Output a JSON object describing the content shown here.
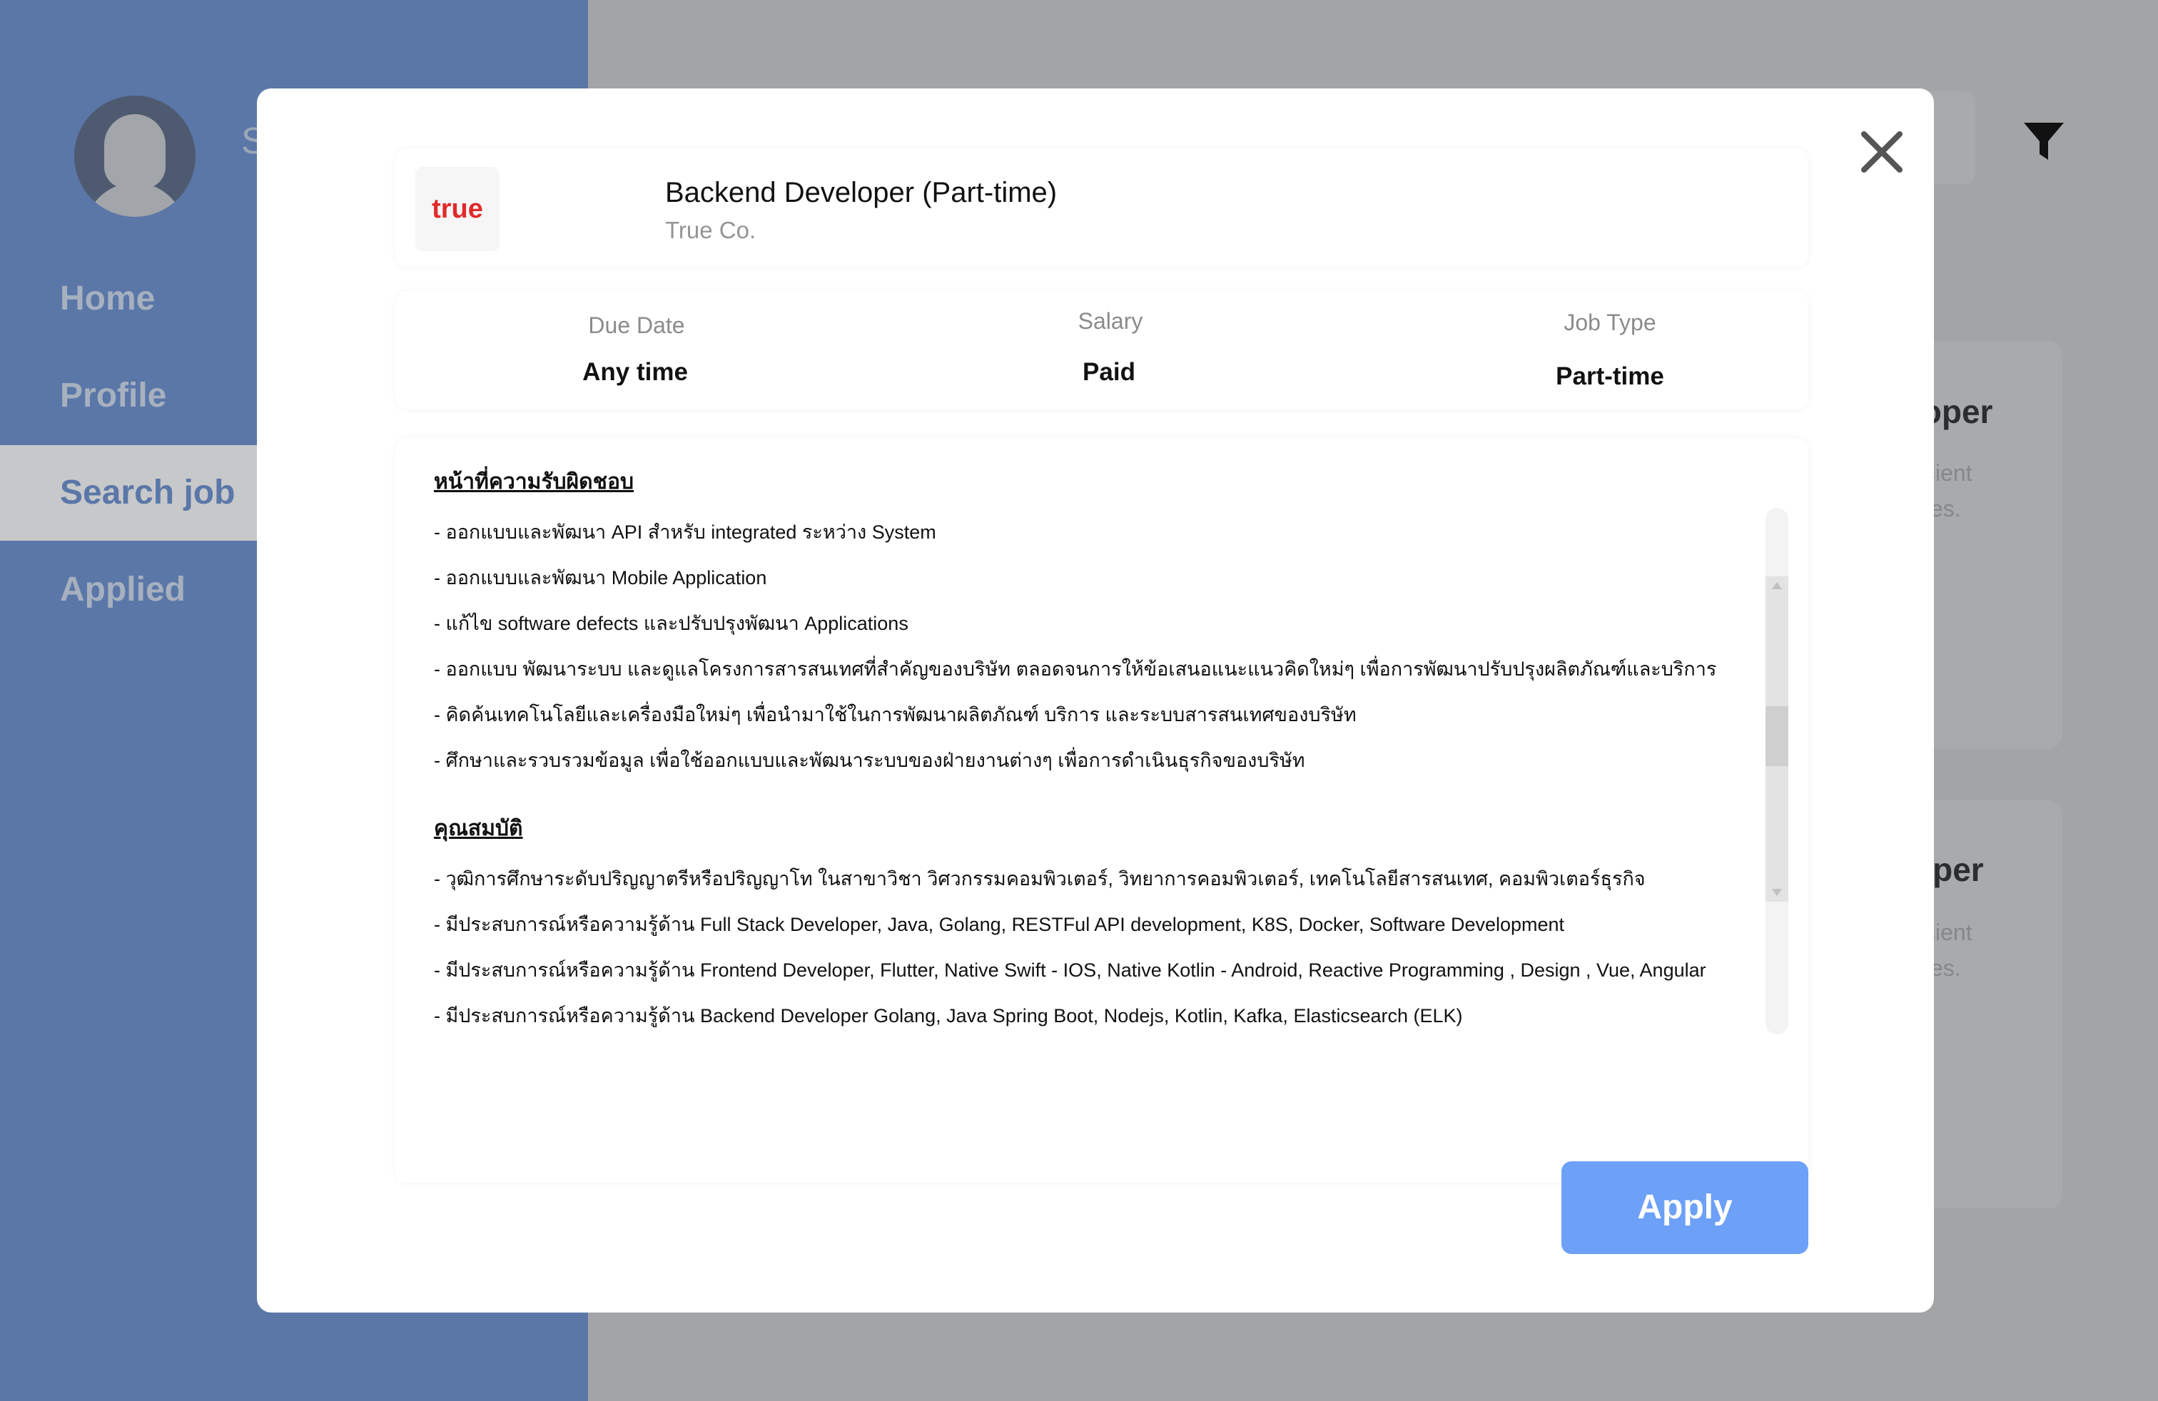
{
  "sidebar": {
    "user_initial": "S",
    "items": [
      {
        "label": "Home"
      },
      {
        "label": "Profile"
      },
      {
        "label": "Search job"
      },
      {
        "label": "Applied"
      }
    ]
  },
  "background_cards": [
    {
      "title_fragment": "loper",
      "line1": "ficient",
      "line2": "gies."
    },
    {
      "title_fragment": "oper",
      "line1": "ficient",
      "line2": "gies."
    }
  ],
  "modal": {
    "logo_text": "true",
    "job_title": "Backend Developer (Part-time)",
    "company": "True Co.",
    "info": {
      "due_date_label": "Due Date",
      "due_date_value": "Any time",
      "salary_label": "Salary",
      "salary_value": "Paid",
      "job_type_label": "Job Type",
      "job_type_value": "Part-time"
    },
    "responsibilities_heading": "หน้าที่ความรับผิดชอบ",
    "responsibilities": [
      "- ออกแบบและพัฒนา API สำหรับ integrated ระหว่าง System",
      "- ออกแบบและพัฒนา Mobile Application",
      "- แก้ไข software defects และปรับปรุงพัฒนา Applications",
      "- ออกแบบ พัฒนาระบบ และดูแลโครงการสารสนเทศที่สำคัญของบริษัท ตลอดจนการให้ข้อเสนอแนะแนวคิดใหม่ๆ เพื่อการพัฒนาปรับปรุงผลิตภัณฑ์และบริการ",
      "- คิดค้นเทคโนโลยีและเครื่องมือใหม่ๆ เพื่อนำมาใช้ในการพัฒนาผลิตภัณฑ์ บริการ และระบบสารสนเทศของบริษัท",
      "- ศึกษาและรวบรวมข้อมูล เพื่อใช้ออกแบบและพัฒนาระบบของฝ่ายงานต่างๆ เพื่อการดำเนินธุรกิจของบริษัท"
    ],
    "qualifications_heading": "คุณสมบัติ",
    "qualifications": [
      "- วุฒิการศึกษาระดับปริญญาตรีหรือปริญญาโท ในสาขาวิชา วิศวกรรมคอมพิวเตอร์, วิทยาการคอมพิวเตอร์, เทคโนโลยีสารสนเทศ, คอมพิวเตอร์ธุรกิจ",
      "- มีประสบการณ์หรือความรู้ด้าน Full Stack Developer, Java, Golang, RESTFul API development, K8S, Docker, Software Development",
      "- มีประสบการณ์หรือความรู้ด้าน Frontend Developer, Flutter, Native Swift - IOS, Native Kotlin - Android, Reactive Programming , Design , Vue, Angular",
      "- มีประสบการณ์หรือความรู้ด้าน Backend Developer Golang, Java Spring Boot, Nodejs, Kotlin, Kafka, Elasticsearch (ELK)"
    ],
    "apply_label": "Apply"
  },
  "colors": {
    "sidebar_bg": "#5a77a8",
    "overlay_bg": "#a3a4a6",
    "apply_button": "#6da0f7",
    "logo_red": "#e02a2a"
  },
  "icons": {
    "close": "close-icon",
    "filter": "filter-icon",
    "avatar": "user-avatar-icon"
  }
}
